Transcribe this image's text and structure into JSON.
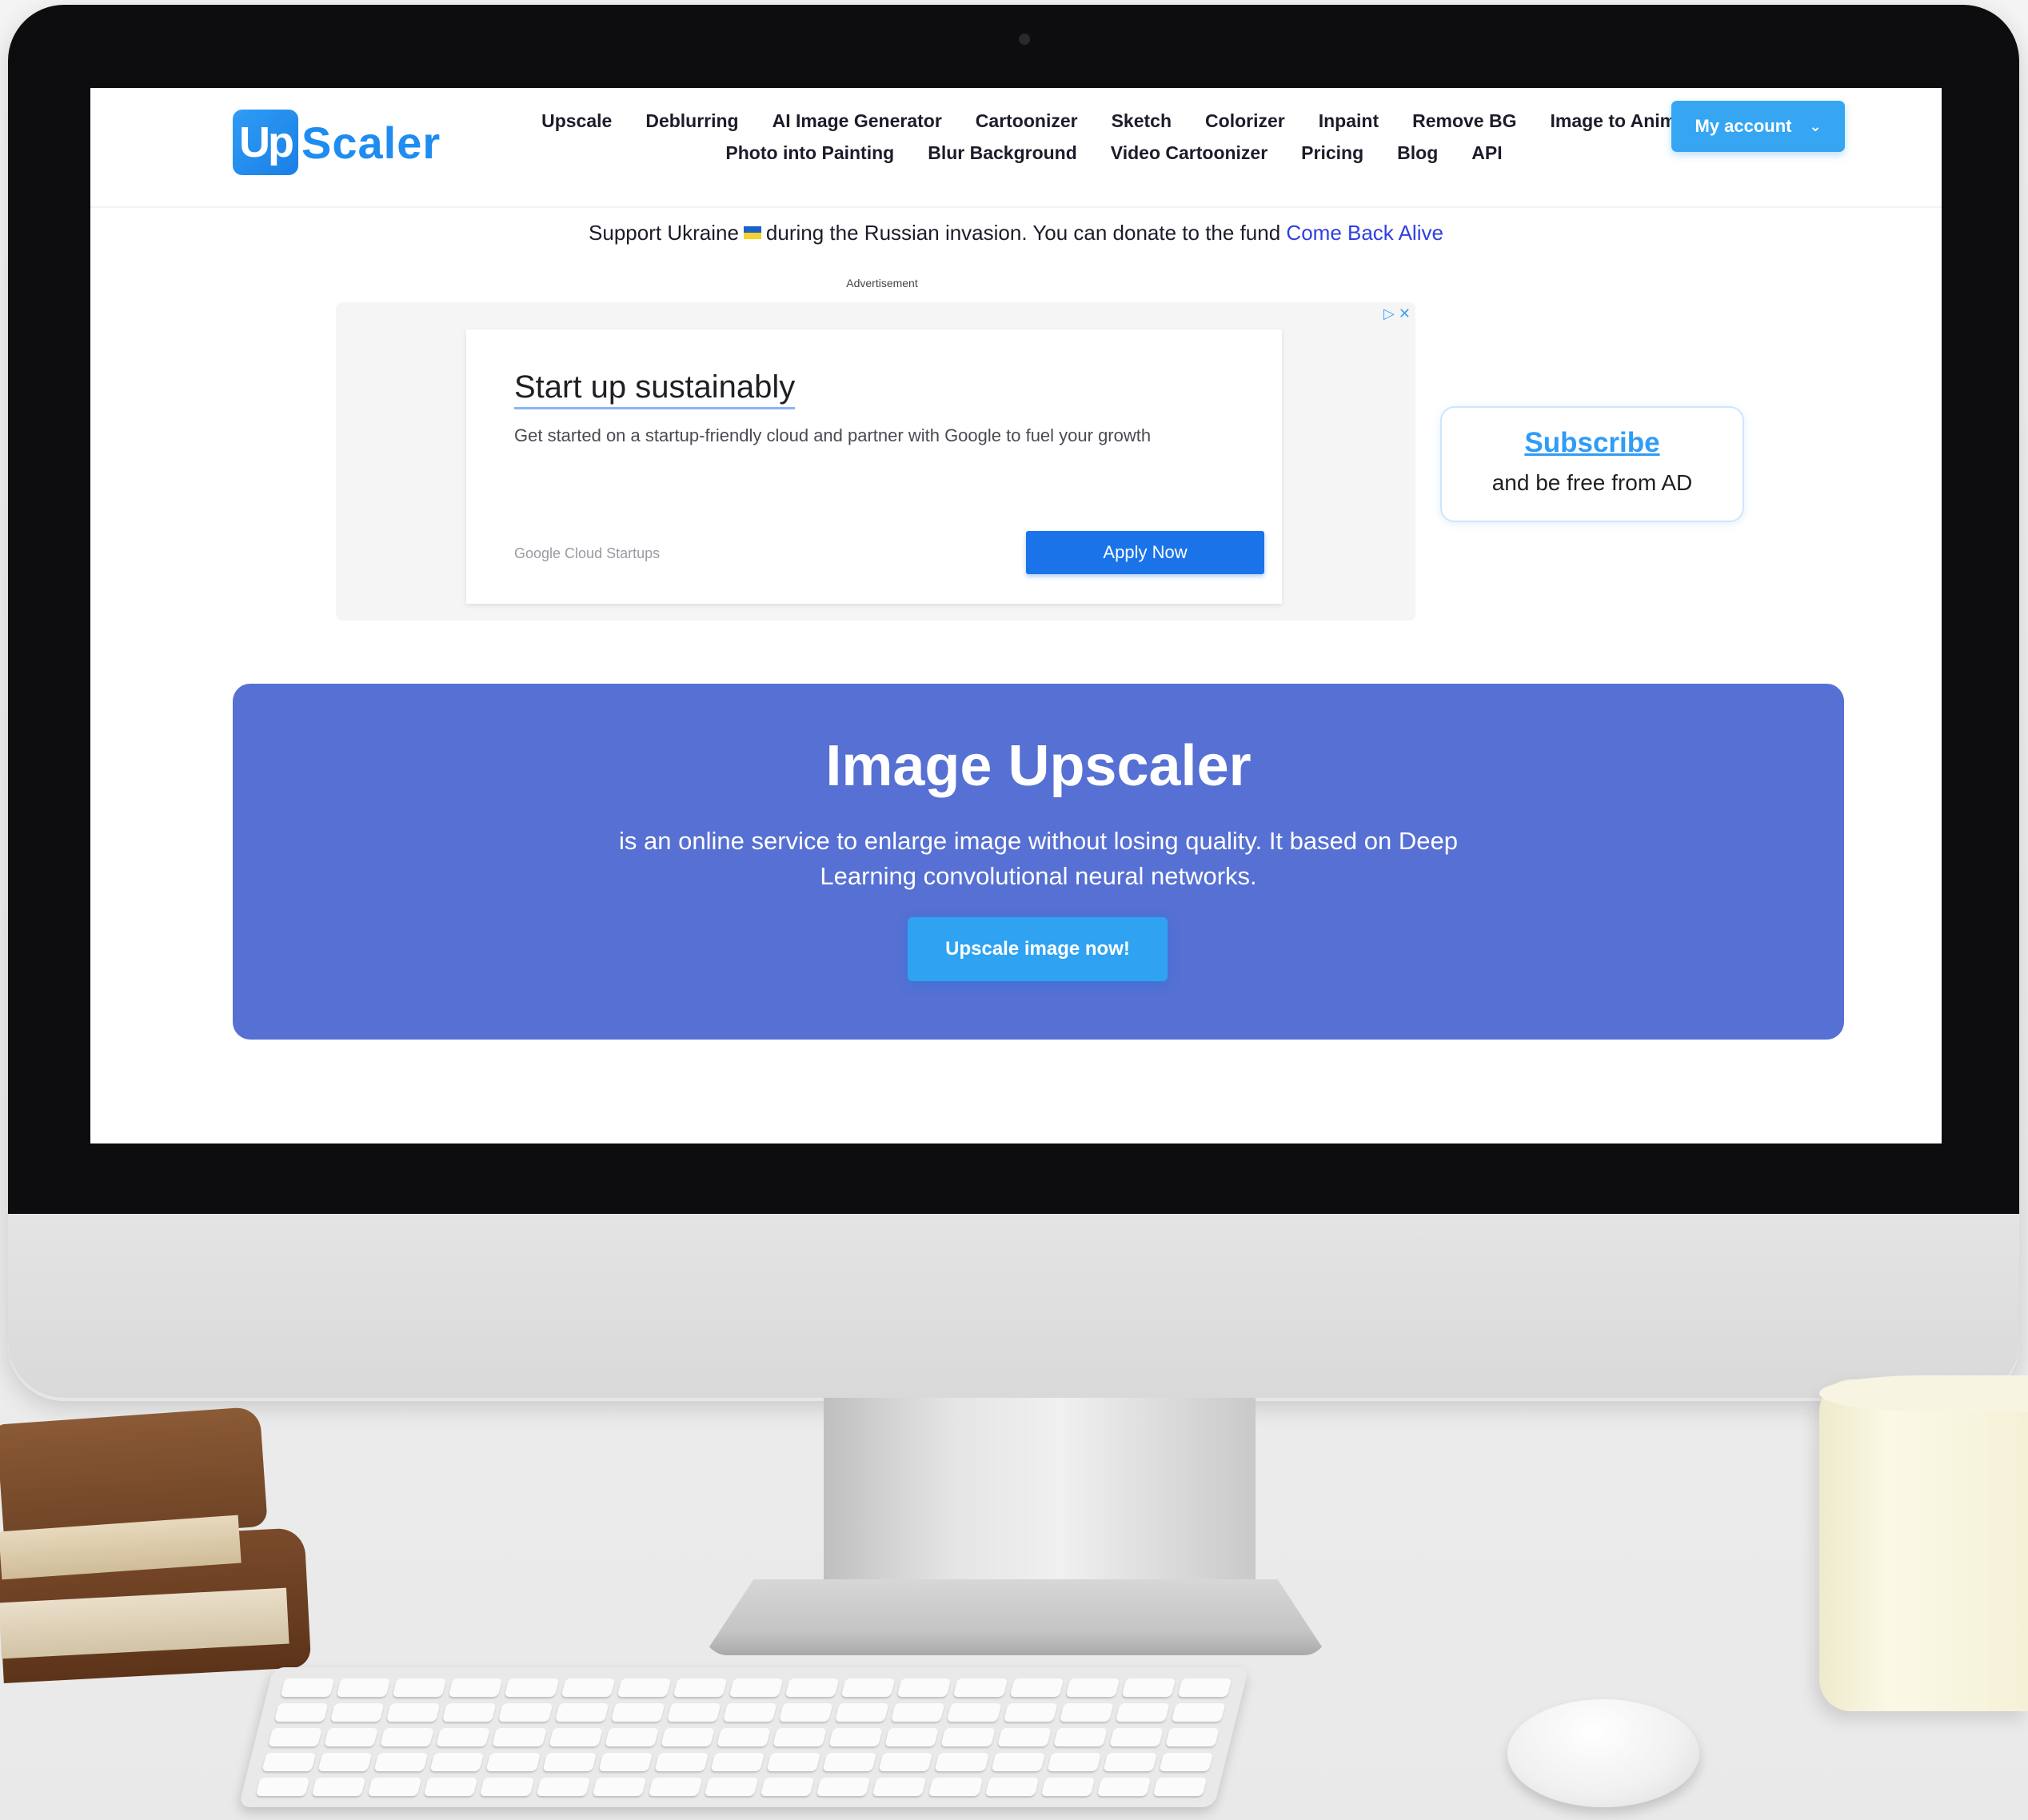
{
  "logo": {
    "box_text": "Up",
    "word": "Scaler"
  },
  "nav": {
    "row1": [
      "Upscale",
      "Deblurring",
      "AI Image Generator",
      "Cartoonizer",
      "Sketch",
      "Colorizer",
      "Inpaint",
      "Remove BG",
      "Image to Anime"
    ],
    "row2": [
      "Photo into Painting",
      "Blur Background",
      "Video Cartoonizer",
      "Pricing",
      "Blog",
      "API"
    ]
  },
  "account": {
    "label": "My account",
    "chevron": "⌄"
  },
  "ukraine": {
    "before": "Support Ukraine",
    "after": "during the Russian invasion. You can donate to the fund",
    "link": "Come Back Alive"
  },
  "ad": {
    "label": "Advertisement",
    "choices": "▷ ✕",
    "title": "Start up sustainably",
    "description": "Get started on a startup-friendly cloud and partner with Google to fuel your growth",
    "brand": "Google Cloud Startups",
    "cta": "Apply Now"
  },
  "subscribe": {
    "link": "Subscribe",
    "text": "and be free from AD"
  },
  "hero": {
    "title": "Image Upscaler",
    "description": "is an online service to enlarge image without losing quality. It based on Deep Learning convolutional neural networks.",
    "button": "Upscale image now!"
  },
  "colors": {
    "brand": "#1e8cf0",
    "account_button": "#36a6f2",
    "hero_background": "#5670d3",
    "hero_button": "#2fa3f2",
    "ad_button": "#1a73e8",
    "link": "#2f3fe0"
  },
  "icons": [
    "ukraine-flag-icon",
    "chevron-down-icon",
    "adchoices-icon",
    "webcam-icon"
  ]
}
